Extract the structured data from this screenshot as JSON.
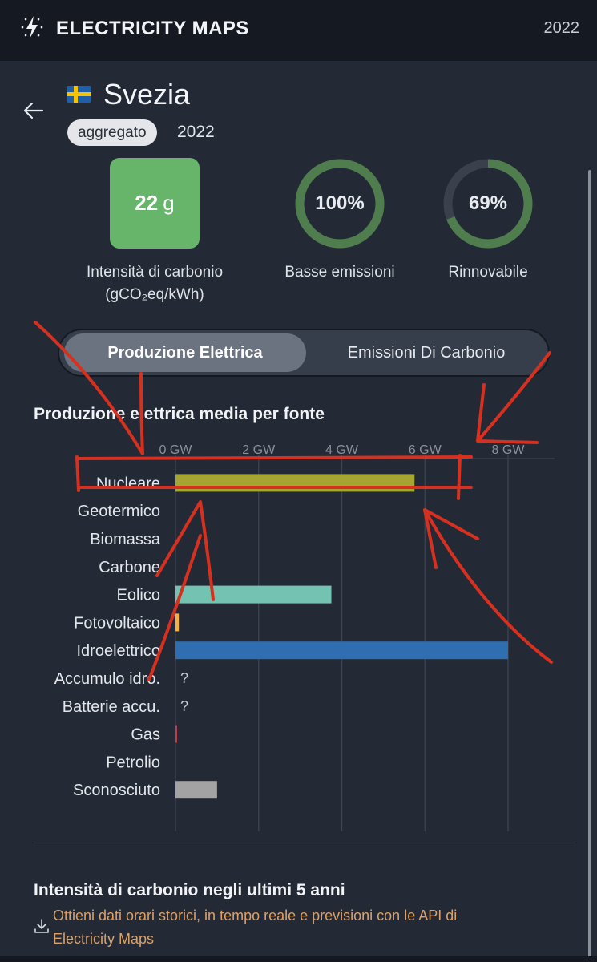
{
  "header": {
    "brand": "ELECTRICITY MAPS",
    "year": "2022",
    "logo_icon": "lightning-bolt-icon"
  },
  "zone": {
    "name": "Svezia",
    "flag": "sweden-flag-icon",
    "badge": "aggregato",
    "year": "2022"
  },
  "metrics": {
    "carbon_value": "22",
    "carbon_unit": "g",
    "carbon_caption_line1": "Intensità di carbonio",
    "carbon_caption_line2": "(gCO₂eq/kWh)",
    "low_emission_value": "100%",
    "low_emission_fraction": 1.0,
    "low_emission_caption": "Basse emissioni",
    "renewable_value": "69%",
    "renewable_fraction": 0.69,
    "renewable_caption": "Rinnovabile"
  },
  "toggle": {
    "active": "Produzione Elettrica",
    "inactive": "Emissioni Di Carbonio"
  },
  "chart_title": "Produzione elettrica media per fonte",
  "chart_data": {
    "type": "bar",
    "title": "Produzione elettrica media per fonte",
    "orientation": "horizontal",
    "unit": "GW",
    "xticks": [
      "0 GW",
      "2 GW",
      "4 GW",
      "6 GW",
      "8 GW"
    ],
    "xlim": [
      0,
      8
    ],
    "categories": [
      "Nucleare",
      "Geotermico",
      "Biomassa",
      "Carbone",
      "Eolico",
      "Fotovoltaico",
      "Idroelettrico",
      "Accumulo idro.",
      "Batterie accu.",
      "Gas",
      "Petrolio",
      "Sconosciuto"
    ],
    "values": [
      5.75,
      0,
      0,
      0,
      3.75,
      0.08,
      8.0,
      null,
      null,
      0.01,
      0,
      1.0
    ],
    "missing_marker": "?",
    "colors": [
      "#a5a532",
      "#8a7b44",
      "#8c5a2b",
      "#2e2e2e",
      "#74c2b2",
      "#f6b03e",
      "#2f6fb1",
      "#264e8f",
      "#3b5a8c",
      "#bf3b50",
      "#82382a",
      "#a3a3a3"
    ]
  },
  "history": {
    "title": "Intensità di carbonio negli ultimi 5 anni",
    "api_line1": "Ottieni dati orari storici, in tempo reale e previsioni con le API di",
    "api_line2": "Electricity Maps",
    "api_icon": "download-icon"
  }
}
